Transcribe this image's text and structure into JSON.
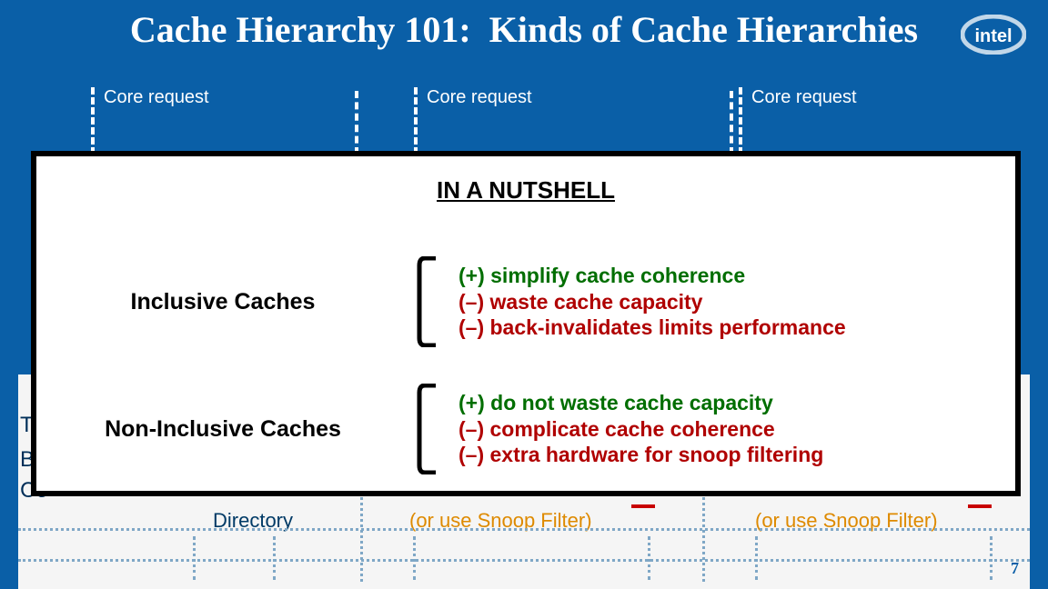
{
  "title": "Cache Hierarchy 101:  Kinds of Cache Hierarchies",
  "core_request": "Core request",
  "side_labels": {
    "l1": "To",
    "l2": "Ba",
    "l3": "Co"
  },
  "nutshell": {
    "heading": "IN A NUTSHELL",
    "inclusive": {
      "label": "Inclusive Caches",
      "pros": "(+) simplify cache coherence",
      "con1": "(–) waste cache capacity",
      "con2": "(–) back-invalidates limits performance"
    },
    "noninclusive": {
      "label": "Non-Inclusive Caches",
      "pros": "(+) do not waste cache capacity",
      "con1": "(–) complicate cache coherence",
      "con2": "(–) extra hardware for snoop filtering"
    }
  },
  "footer": {
    "directory": "Directory",
    "snoop": "(or use Snoop Filter)"
  },
  "page_number": "7"
}
